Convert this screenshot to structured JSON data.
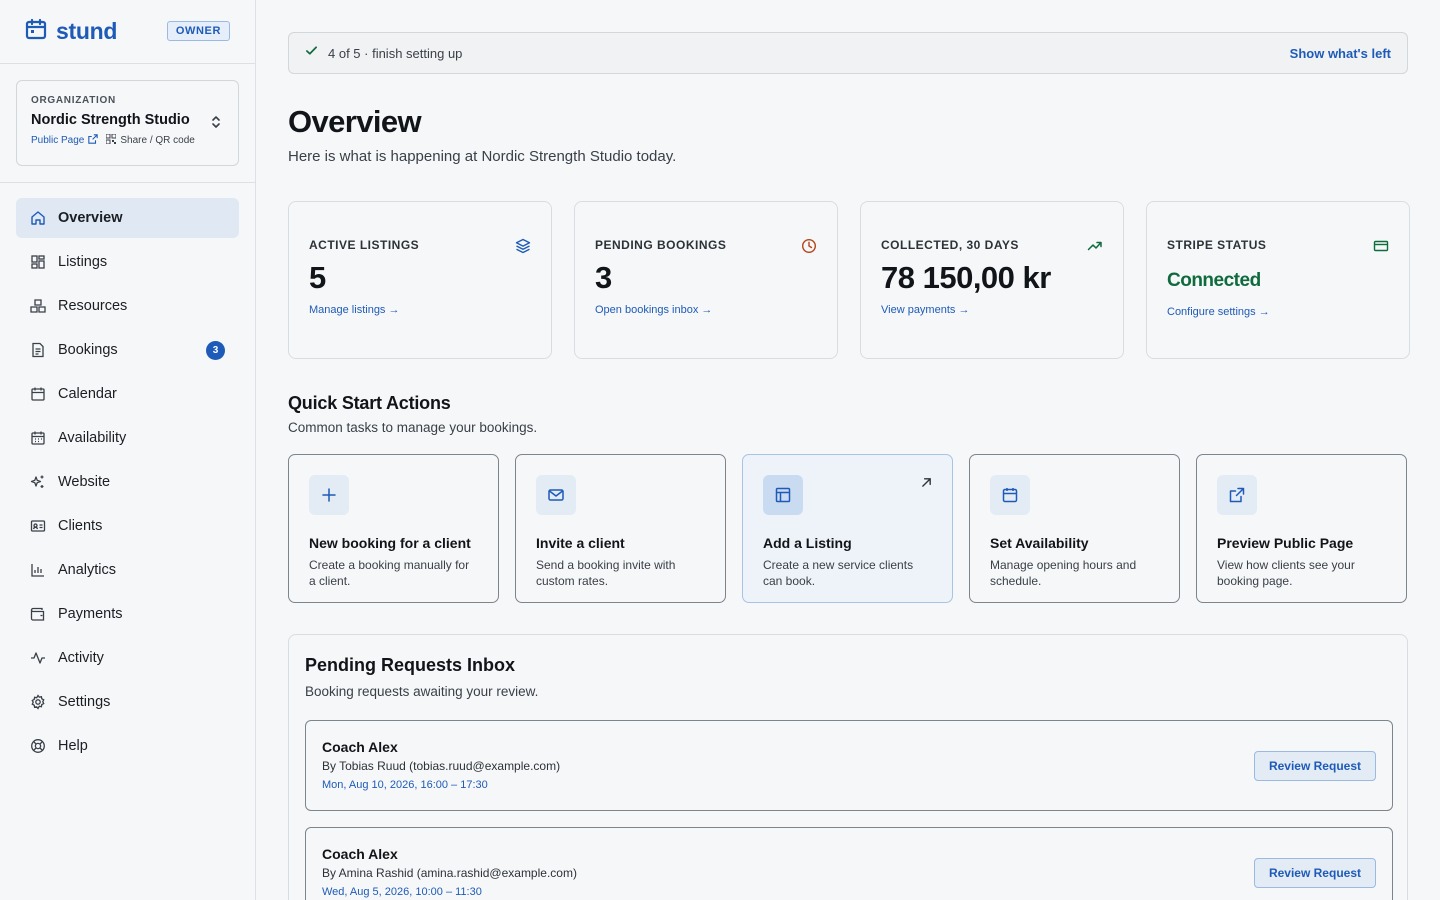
{
  "brand": {
    "name": "stund",
    "badge": "OWNER"
  },
  "organization": {
    "label": "ORGANIZATION",
    "name": "Nordic Strength Studio",
    "public_page": "Public Page",
    "share": "Share / QR code"
  },
  "nav": {
    "items": [
      {
        "label": "Overview",
        "icon": "home-icon",
        "active": true
      },
      {
        "label": "Listings",
        "icon": "grid-icon"
      },
      {
        "label": "Resources",
        "icon": "boxes-icon"
      },
      {
        "label": "Bookings",
        "icon": "document-icon",
        "badge": "3"
      },
      {
        "label": "Calendar",
        "icon": "calendar-icon"
      },
      {
        "label": "Availability",
        "icon": "calendar-grid-icon"
      },
      {
        "label": "Website",
        "icon": "sparkles-icon"
      },
      {
        "label": "Clients",
        "icon": "id-card-icon"
      },
      {
        "label": "Analytics",
        "icon": "bar-chart-icon"
      },
      {
        "label": "Payments",
        "icon": "wallet-icon"
      },
      {
        "label": "Activity",
        "icon": "pulse-icon"
      },
      {
        "label": "Settings",
        "icon": "gear-icon"
      },
      {
        "label": "Help",
        "icon": "lifebuoy-icon"
      }
    ]
  },
  "setup": {
    "text": "4 of 5 · finish setting up",
    "link": "Show what's left"
  },
  "page": {
    "title": "Overview",
    "subtitle": "Here is what is happening at Nordic Strength Studio today."
  },
  "stats": [
    {
      "label": "ACTIVE LISTINGS",
      "value": "5",
      "link": "Manage listings →",
      "icon": "layers-icon",
      "icon_color": "#1e5bb8"
    },
    {
      "label": "PENDING BOOKINGS",
      "value": "3",
      "link": "Open bookings inbox →",
      "icon": "clock-icon",
      "icon_color": "#b4451a"
    },
    {
      "label": "COLLECTED, 30 DAYS",
      "value": "78 150,00 kr",
      "link": "View payments →",
      "icon": "trending-up-icon",
      "icon_color": "#0f6b3e"
    },
    {
      "label": "STRIPE STATUS",
      "value": "Connected",
      "link": "Configure settings →",
      "icon": "credit-card-icon",
      "icon_color": "#0f6b3e"
    }
  ],
  "quick_start": {
    "title": "Quick Start Actions",
    "subtitle": "Common tasks to manage your bookings.",
    "cards": [
      {
        "title": "New booking for a client",
        "desc": "Create a booking manually for a client.",
        "icon": "plus-icon"
      },
      {
        "title": "Invite a client",
        "desc": "Send a booking invite with custom rates.",
        "icon": "mail-icon"
      },
      {
        "title": "Add a Listing",
        "desc": "Create a new service clients can book.",
        "icon": "layout-icon",
        "highlight": true
      },
      {
        "title": "Set Availability",
        "desc": "Manage opening hours and schedule.",
        "icon": "calendar-icon"
      },
      {
        "title": "Preview Public Page",
        "desc": "View how clients see your booking page.",
        "icon": "external-link-icon"
      }
    ]
  },
  "inbox": {
    "title": "Pending Requests Inbox",
    "subtitle": "Booking requests awaiting your review.",
    "requests": [
      {
        "name": "Coach Alex",
        "by": "By Tobias Ruud (tobias.ruud@example.com)",
        "time": "Mon, Aug 10, 2026, 16:00 – 17:30",
        "action": "Review Request"
      },
      {
        "name": "Coach Alex",
        "by": "By Amina Rashid (amina.rashid@example.com)",
        "time": "Wed, Aug 5, 2026, 10:00 – 11:30",
        "action": "Review Request"
      }
    ]
  }
}
